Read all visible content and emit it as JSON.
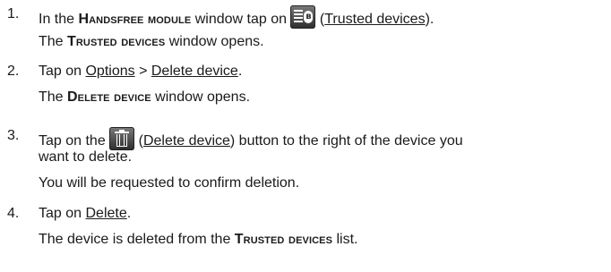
{
  "steps": [
    {
      "number": "1.",
      "text_before": "In the ",
      "window_name": "Handsfree module",
      "text_middle": " window tap on ",
      "icon": "trusted-devices-icon",
      "paren_open": " (",
      "link": "Trusted devices",
      "paren_close": ").",
      "result_prefix": "The ",
      "result_window": "Trusted devices",
      "result_suffix": " window opens."
    },
    {
      "number": "2.",
      "text_before": "Tap on ",
      "link_options": "Options",
      "separator": " > ",
      "link_delete": "Delete device",
      "text_after": ".",
      "result_prefix": "The ",
      "result_window": "Delete device",
      "result_suffix": " window opens."
    },
    {
      "number": "3.",
      "text_before": "Tap on the ",
      "icon": "trash-icon",
      "paren_open": " (",
      "link": "Delete device",
      "paren_close": ")",
      "text_after": " button to the right of the device you",
      "continuation": "want to delete.",
      "result": "You will be requested to confirm deletion."
    },
    {
      "number": "4.",
      "text_before": "Tap on ",
      "link": "Delete",
      "text_after": ".",
      "result_prefix": "The device is deleted from the ",
      "result_window": "Trusted devices",
      "result_suffix": " list."
    }
  ]
}
